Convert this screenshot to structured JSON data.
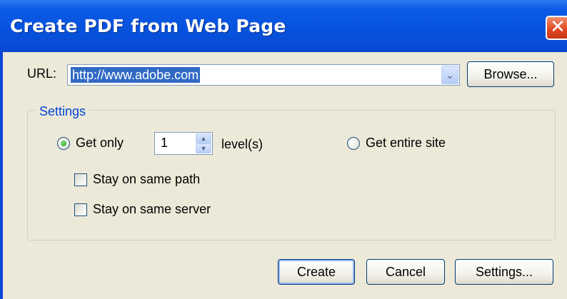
{
  "window": {
    "title": "Create PDF from Web Page",
    "close_symbol": "✕"
  },
  "url": {
    "label": "URL:",
    "value": "http://www.adobe.com",
    "dropdown_symbol": "⌄",
    "browse_label": "Browse..."
  },
  "settings": {
    "group_label": "Settings",
    "get_only_label": "Get only",
    "levels_value": "1",
    "levels_label": "level(s)",
    "get_entire_site_label": "Get entire site",
    "stay_same_path_label": "Stay on same path",
    "stay_same_server_label": "Stay on same server",
    "selected_option": "get_only",
    "stay_same_path_checked": false,
    "stay_same_server_checked": false
  },
  "buttons": {
    "create_label": "Create",
    "cancel_label": "Cancel",
    "settings_label": "Settings..."
  },
  "colors": {
    "titlebar": "#0753de",
    "selection": "#316ac5",
    "group_label": "#0046d5"
  }
}
